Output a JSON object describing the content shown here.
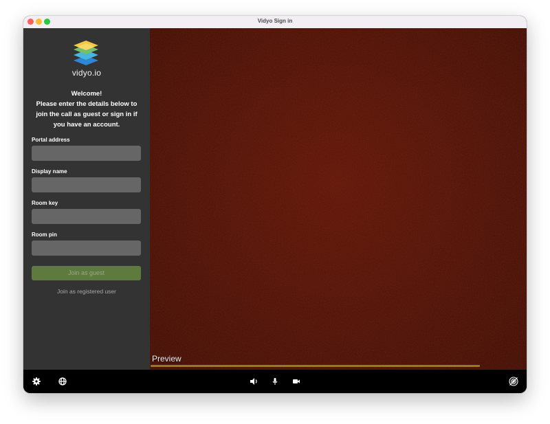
{
  "window": {
    "title": "Vidyo Sign in"
  },
  "brand": {
    "logo_text": "vidyo.io"
  },
  "welcome": {
    "heading": "Welcome!",
    "body": "Please enter the details below to join the call as guest or sign in if you have an account."
  },
  "form": {
    "portal_label": "Portal address",
    "portal_value": "",
    "display_name_label": "Display name",
    "display_name_value": "",
    "room_key_label": "Room key",
    "room_key_value": "",
    "room_pin_label": "Room pin",
    "room_pin_value": ""
  },
  "actions": {
    "join_guest": "Join as guest",
    "join_registered": "Join as registered user"
  },
  "preview": {
    "label": "Preview"
  },
  "toolbar": {
    "icons": [
      "gear-icon",
      "globe-icon",
      "speaker-icon",
      "microphone-icon",
      "camera-icon",
      "network-status-icon"
    ]
  },
  "colors": {
    "sidebar": "#333333",
    "input": "#666666",
    "join_button": "#5e7a3c",
    "preview_background": "#4b1107",
    "audio_meter": "#9b7a16",
    "toolbar": "#000000"
  }
}
